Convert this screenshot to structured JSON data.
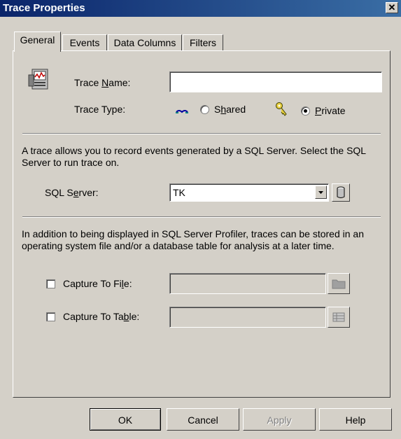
{
  "window": {
    "title": "Trace Properties",
    "close_glyph": "✕"
  },
  "tabs": [
    "General",
    "Events",
    "Data Columns",
    "Filters"
  ],
  "general": {
    "trace_name_label": {
      "pre": "Trace ",
      "key": "N",
      "post": "ame:"
    },
    "trace_name_value": "",
    "trace_type_label": "Trace Type:",
    "shared": {
      "pre": "S",
      "key": "h",
      "post": "ared",
      "selected": false
    },
    "private": {
      "pre": "",
      "key": "P",
      "post": "rivate",
      "selected": true
    },
    "info_text_1": "A trace allows you to record events generated by a SQL Server. Select the SQL Server to run trace on.",
    "sql_server_label": {
      "pre": "SQL S",
      "key": "e",
      "post": "rver:"
    },
    "sql_server_value": "TK",
    "info_text_2": "In addition to being displayed in SQL Server Profiler, traces can be stored in an operating system file and/or a database table for analysis at a later time.",
    "capture_file": {
      "pre": "Capture To Fi",
      "key": "l",
      "post": "e:",
      "checked": false,
      "value": ""
    },
    "capture_table": {
      "pre": "Capture To Ta",
      "key": "b",
      "post": "le:",
      "checked": false,
      "value": ""
    }
  },
  "buttons": {
    "ok": "OK",
    "cancel": "Cancel",
    "apply": "Apply",
    "help": "Help"
  },
  "icons": [
    "trace-properties-icon",
    "shared-trace-icon",
    "private-key-icon",
    "server-browse-icon",
    "folder-browse-icon",
    "table-browse-icon"
  ],
  "colors": {
    "titlebar_start": "#0a246a",
    "titlebar_end": "#3a6ea5",
    "face": "#d4d0c8"
  }
}
